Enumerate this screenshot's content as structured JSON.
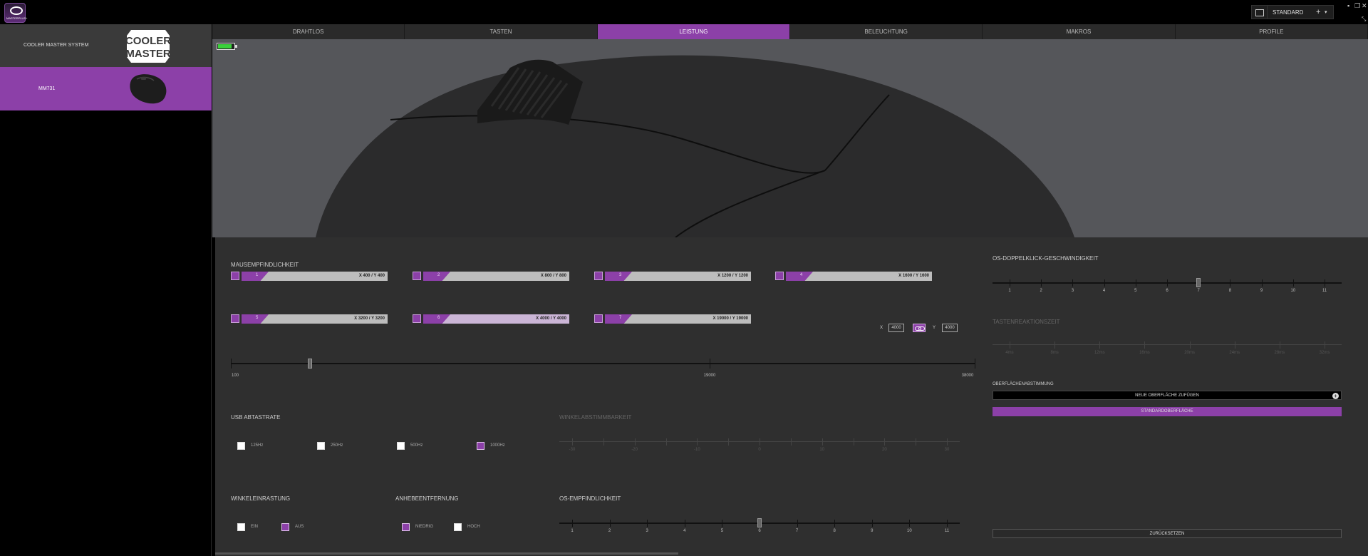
{
  "app": {
    "logo_text": "MASTERPLUS+",
    "profile_name": "STANDARD"
  },
  "window": {
    "minimize": "▪",
    "restore": "❐",
    "close": "✕"
  },
  "sidebar": {
    "system_label": "COOLER MASTER SYSTEM",
    "brand_logo": {
      "line1": "COOLER",
      "line2": "MASTER"
    },
    "device_label": "MM731"
  },
  "tabs": [
    "DRAHTLOS",
    "TASTEN",
    "LEISTUNG",
    "BELEUCHTUNG",
    "MAKROS",
    "PROFILE"
  ],
  "active_tab": 2,
  "battery": {
    "level": 0.85,
    "color": "#3bd13b"
  },
  "sensitivity": {
    "title": "MAUSEMPFINDLICHKEIT",
    "stages": [
      {
        "n": "1",
        "value": "X 400 / Y 400"
      },
      {
        "n": "2",
        "value": "X 800 / Y 800"
      },
      {
        "n": "3",
        "value": "X 1200 / Y 1200"
      },
      {
        "n": "4",
        "value": "X 1600 / Y 1600"
      },
      {
        "n": "5",
        "value": "X 3200 / Y 3200"
      },
      {
        "n": "6",
        "value": "X 4000 / Y 4000"
      },
      {
        "n": "7",
        "value": "X 19000 / Y 19000"
      }
    ],
    "x_label": "X",
    "x_value": "4000",
    "y_label": "Y",
    "y_value": "4000",
    "scale": {
      "min": "100",
      "mid": "19000",
      "max": "38000",
      "position": 0.103
    }
  },
  "usb": {
    "title": "USB ABTASTRATE",
    "options": [
      {
        "label": "125Hz",
        "on": false
      },
      {
        "label": "250Hz",
        "on": false
      },
      {
        "label": "500Hz",
        "on": false
      },
      {
        "label": "1000Hz",
        "on": true
      }
    ]
  },
  "angle_tuning": {
    "title": "WINKELABSTIMMBARKEIT",
    "ticks": [
      "-30",
      "",
      "-20",
      "",
      "-10",
      "",
      "0",
      "",
      "10",
      "",
      "20",
      "",
      "30"
    ]
  },
  "angle_snap": {
    "title": "WINKELEINRASTUNG",
    "options": [
      {
        "label": "EIN",
        "on": false
      },
      {
        "label": "AUS",
        "on": true
      }
    ]
  },
  "lift_off": {
    "title": "ANHEBEENTFERNUNG",
    "options": [
      {
        "label": "NIEDRIG",
        "on": true
      },
      {
        "label": "HOCH",
        "on": false
      }
    ]
  },
  "os_sensitivity": {
    "title": "OS-EMPFINDLICHKEIT",
    "ticks": [
      "1",
      "2",
      "3",
      "4",
      "5",
      "6",
      "7",
      "8",
      "9",
      "10",
      "11"
    ],
    "value": 6
  },
  "double_click": {
    "title": "OS-DOPPELKLICK-GESCHWINDIGKEIT",
    "ticks": [
      "1",
      "2",
      "3",
      "4",
      "5",
      "6",
      "7",
      "8",
      "9",
      "10",
      "11"
    ],
    "value": 7
  },
  "debounce": {
    "title": "TASTENREAKTIONSZEIT",
    "ticks": [
      "4ms",
      "8ms",
      "12ms",
      "16ms",
      "20ms",
      "24ms",
      "28ms",
      "32ms"
    ]
  },
  "surface": {
    "title": "OBERFLÄCHENABSTIMMUNG",
    "add_label": "NEUE OBERFLÄCHE ZUFÜGEN",
    "default_label": "STANDARDOBERFLÄCHE"
  },
  "reset_label": "ZURÜCKSETZEN",
  "colors": {
    "accent": "#8c40a8",
    "panel": "#2f2f2f",
    "hero": "#55565a"
  }
}
